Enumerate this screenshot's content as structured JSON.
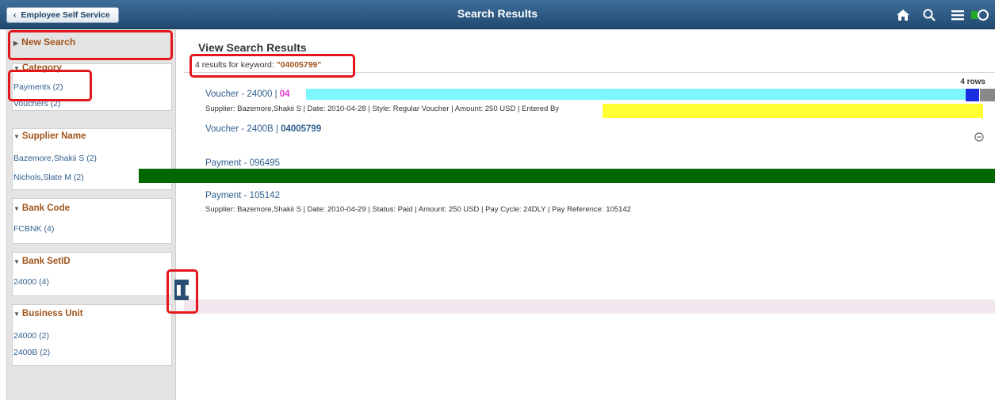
{
  "header": {
    "back_label": "Employee Self Service",
    "title": "Search Results",
    "icons": [
      "home-icon",
      "search-icon",
      "menu-icon"
    ]
  },
  "sidebar": {
    "new_search": "New Search",
    "facets": [
      {
        "title": "Category",
        "items": [
          "Payments (2)",
          "Vouchers (2)"
        ]
      },
      {
        "title": "Supplier Name",
        "items": [
          "Bazemore,Shakii S (2)",
          "Nichols,Slate M (2)"
        ]
      },
      {
        "title": "Bank Code",
        "items": [
          "FCBNK (4)"
        ]
      },
      {
        "title": "Bank SetID",
        "items": [
          "24000 (4)"
        ]
      },
      {
        "title": "Business Unit",
        "items": [
          "24000 (2)",
          "2400B (2)"
        ]
      }
    ]
  },
  "main": {
    "heading": "View Search Results",
    "count_prefix": "4 results for keyword: ",
    "keyword": "\"04005799\"",
    "rows_label": "4 rows",
    "results": [
      {
        "title_prefix": "Voucher - 24000 | ",
        "title_strong": "04",
        "desc": "Supplier: Bazemore,Shakii S | Date: 2010-04-28 | Style: Regular Voucher | Amount: 250 USD | Entered By"
      },
      {
        "title_prefix": "Voucher - 2400B | ",
        "title_strong": "04005799",
        "desc": ""
      },
      {
        "title_prefix": "Payment - 096495",
        "title_strong": "",
        "desc": ""
      },
      {
        "title_prefix": "Payment - 105142",
        "title_strong": "",
        "desc": "Supplier: Bazemore,Shakii S | Date: 2010-04-29 | Status: Paid | Amount: 250 USD | Pay Cycle: 24DLY | Pay Reference: 105142"
      }
    ]
  },
  "colors": {
    "header_bg": "#2c5680",
    "facet_title": "#a0541b",
    "link": "#2f5f8f",
    "annotation_red": "#e3161b"
  }
}
